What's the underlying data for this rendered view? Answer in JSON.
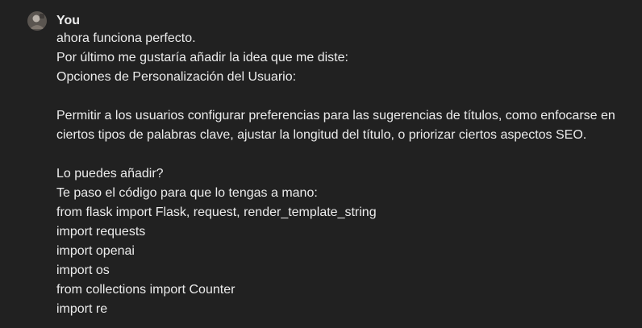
{
  "message": {
    "author": "You",
    "avatar_icon": "user-avatar-photo",
    "lines_top": [
      "ahora funciona perfecto.",
      "Por último me gustaría añadir la idea que me diste:",
      "Opciones de Personalización del Usuario:"
    ],
    "paragraph": "Permitir a los usuarios configurar preferencias para las sugerencias de títulos, como enfocarse en ciertos tipos de palabras clave, ajustar la longitud del título, o priorizar ciertos aspectos SEO.",
    "lines_bottom": [
      "Lo puedes añadir?",
      "Te paso el código para que lo tengas a mano:",
      "from flask import Flask, request, render_template_string",
      "import requests",
      "import openai",
      "import os",
      "from collections import Counter",
      "import re"
    ]
  }
}
